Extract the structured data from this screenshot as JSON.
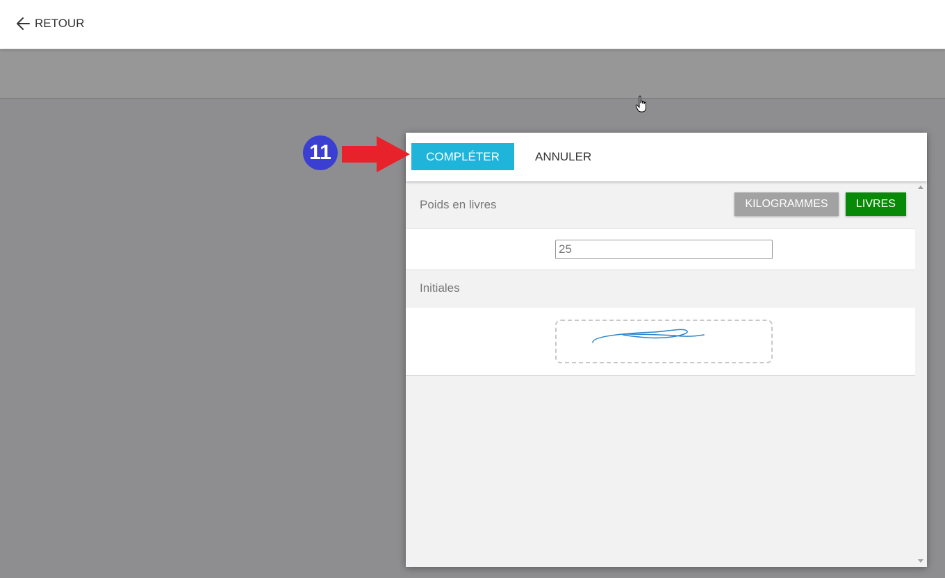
{
  "appbar": {
    "back_label": "RETOUR",
    "back_icon": "arrow-left-icon"
  },
  "annotation": {
    "step_number": "11",
    "step_color": "#3b3fd1",
    "arrow_color": "#e8222a"
  },
  "dialog": {
    "complete_label": "COMPLÉTER",
    "cancel_label": "ANNULER",
    "complete_color": "#1fb4d9",
    "weight": {
      "label": "Poids en livres",
      "unit_options": [
        "KILOGRAMMES",
        "LIVRES"
      ],
      "selected_unit": "LIVRES",
      "value": "25"
    },
    "initials": {
      "label": "Initiales",
      "signed": true
    }
  },
  "colors": {
    "overlay": "#8e8e90",
    "unit_inactive": "#a2a2a2",
    "unit_active": "#088a08"
  }
}
